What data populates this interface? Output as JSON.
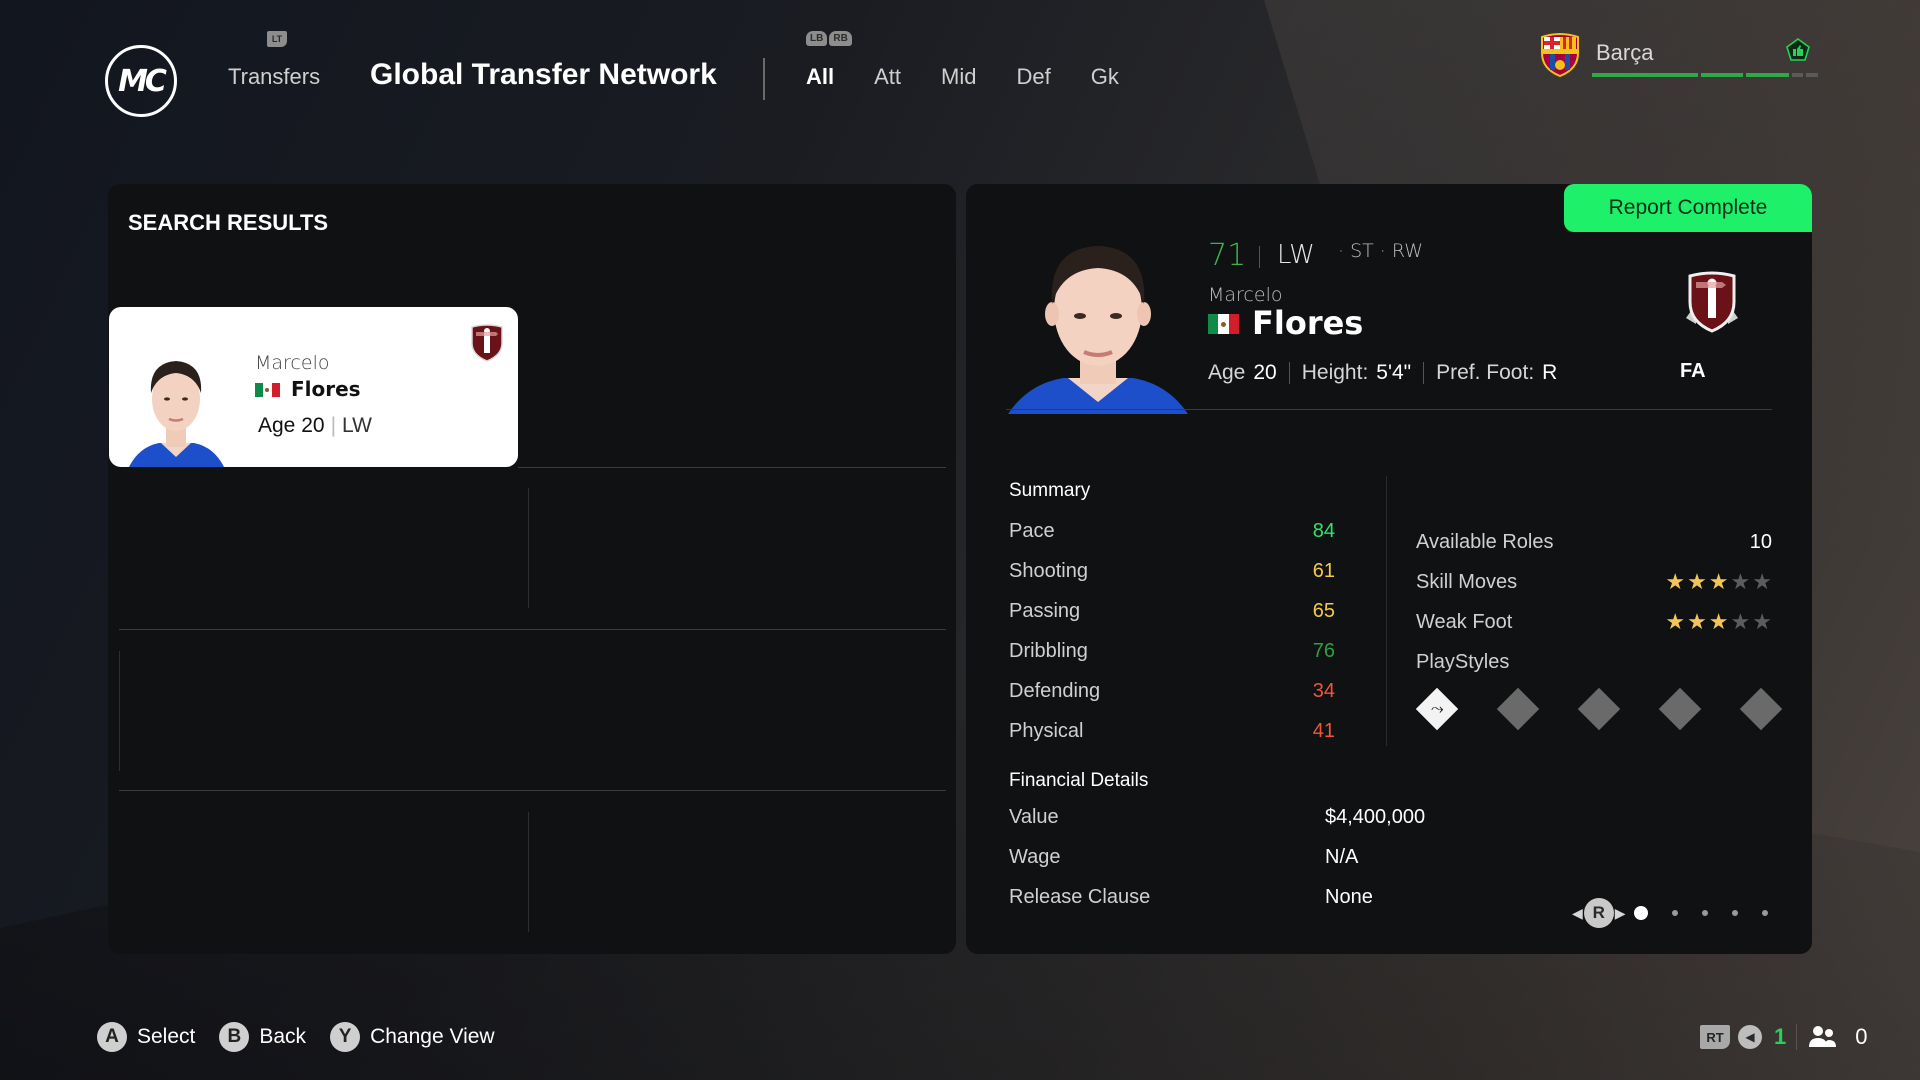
{
  "header": {
    "logo_text": "MC",
    "lt_hint": "LT",
    "breadcrumb_parent": "Transfers",
    "title": "Global Transfer Network",
    "lb_hint": "LB",
    "rb_hint": "RB",
    "tabs": [
      {
        "label": "All",
        "active": true
      },
      {
        "label": "Att",
        "active": false
      },
      {
        "label": "Mid",
        "active": false
      },
      {
        "label": "Def",
        "active": false
      },
      {
        "label": "Gk",
        "active": false
      }
    ],
    "club": {
      "name": "Barça",
      "icon": "thumbs-up-icon",
      "progress_segments": [
        {
          "filled": 1.0,
          "color": "#2fa84a"
        },
        {
          "filled": 1.0,
          "color": "#2fa84a"
        },
        {
          "filled": 1.0,
          "color": "#2fa84a"
        },
        {
          "filled": 0.0,
          "color": "#5a5a5a"
        },
        {
          "filled": 0.0,
          "color": "#5a5a5a"
        }
      ]
    }
  },
  "search_results": {
    "title": "SEARCH RESULTS",
    "cards": [
      {
        "first_name": "Marcelo",
        "last_name": "Flores",
        "nation": "Mexico",
        "age_label": "Age",
        "age": "20",
        "position": "LW",
        "badge": "free-agent-shield-icon"
      }
    ]
  },
  "player": {
    "report_status": "Report Complete",
    "overall": "71",
    "position": "LW",
    "alt_positions": "· ST · RW",
    "first_name": "Marcelo",
    "last_name": "Flores",
    "nation": "Mexico",
    "age_label": "Age",
    "age": "20",
    "height_label": "Height:",
    "height": "5'4\"",
    "foot_label": "Pref. Foot:",
    "foot": "R",
    "club_status": "FA",
    "summary_title": "Summary",
    "stats": [
      {
        "label": "Pace",
        "value": "84",
        "color": "#2fe46c"
      },
      {
        "label": "Shooting",
        "value": "61",
        "color": "#f2c94c"
      },
      {
        "label": "Passing",
        "value": "65",
        "color": "#f2c94c"
      },
      {
        "label": "Dribbling",
        "value": "76",
        "color": "#2e9e46"
      },
      {
        "label": "Defending",
        "value": "34",
        "color": "#f0553a"
      },
      {
        "label": "Physical",
        "value": "41",
        "color": "#f0553a"
      }
    ],
    "available_roles_label": "Available Roles",
    "available_roles": "10",
    "skill_moves_label": "Skill Moves",
    "skill_moves": 3,
    "weak_foot_label": "Weak Foot",
    "weak_foot": 3,
    "star_max": 5,
    "playstyles_label": "PlayStyles",
    "playstyles": [
      {
        "icon": "tactical-playstyle-icon",
        "active": true
      },
      {
        "icon": "empty-playstyle-slot",
        "active": false
      },
      {
        "icon": "empty-playstyle-slot",
        "active": false
      },
      {
        "icon": "empty-playstyle-slot",
        "active": false
      },
      {
        "icon": "empty-playstyle-slot",
        "active": false
      }
    ],
    "financial_title": "Financial Details",
    "financial": [
      {
        "label": "Value",
        "value": "$4,400,000"
      },
      {
        "label": "Wage",
        "value": "N/A"
      },
      {
        "label": "Release Clause",
        "value": "None"
      }
    ],
    "pager": {
      "button": "R",
      "pages": 5,
      "current": 1
    }
  },
  "footer": {
    "hints": [
      {
        "button": "A",
        "label": "Select"
      },
      {
        "button": "B",
        "label": "Back"
      },
      {
        "button": "Y",
        "label": "Change View"
      }
    ],
    "rt_hint": "RT",
    "voice_count": "1",
    "players_count": "0"
  }
}
